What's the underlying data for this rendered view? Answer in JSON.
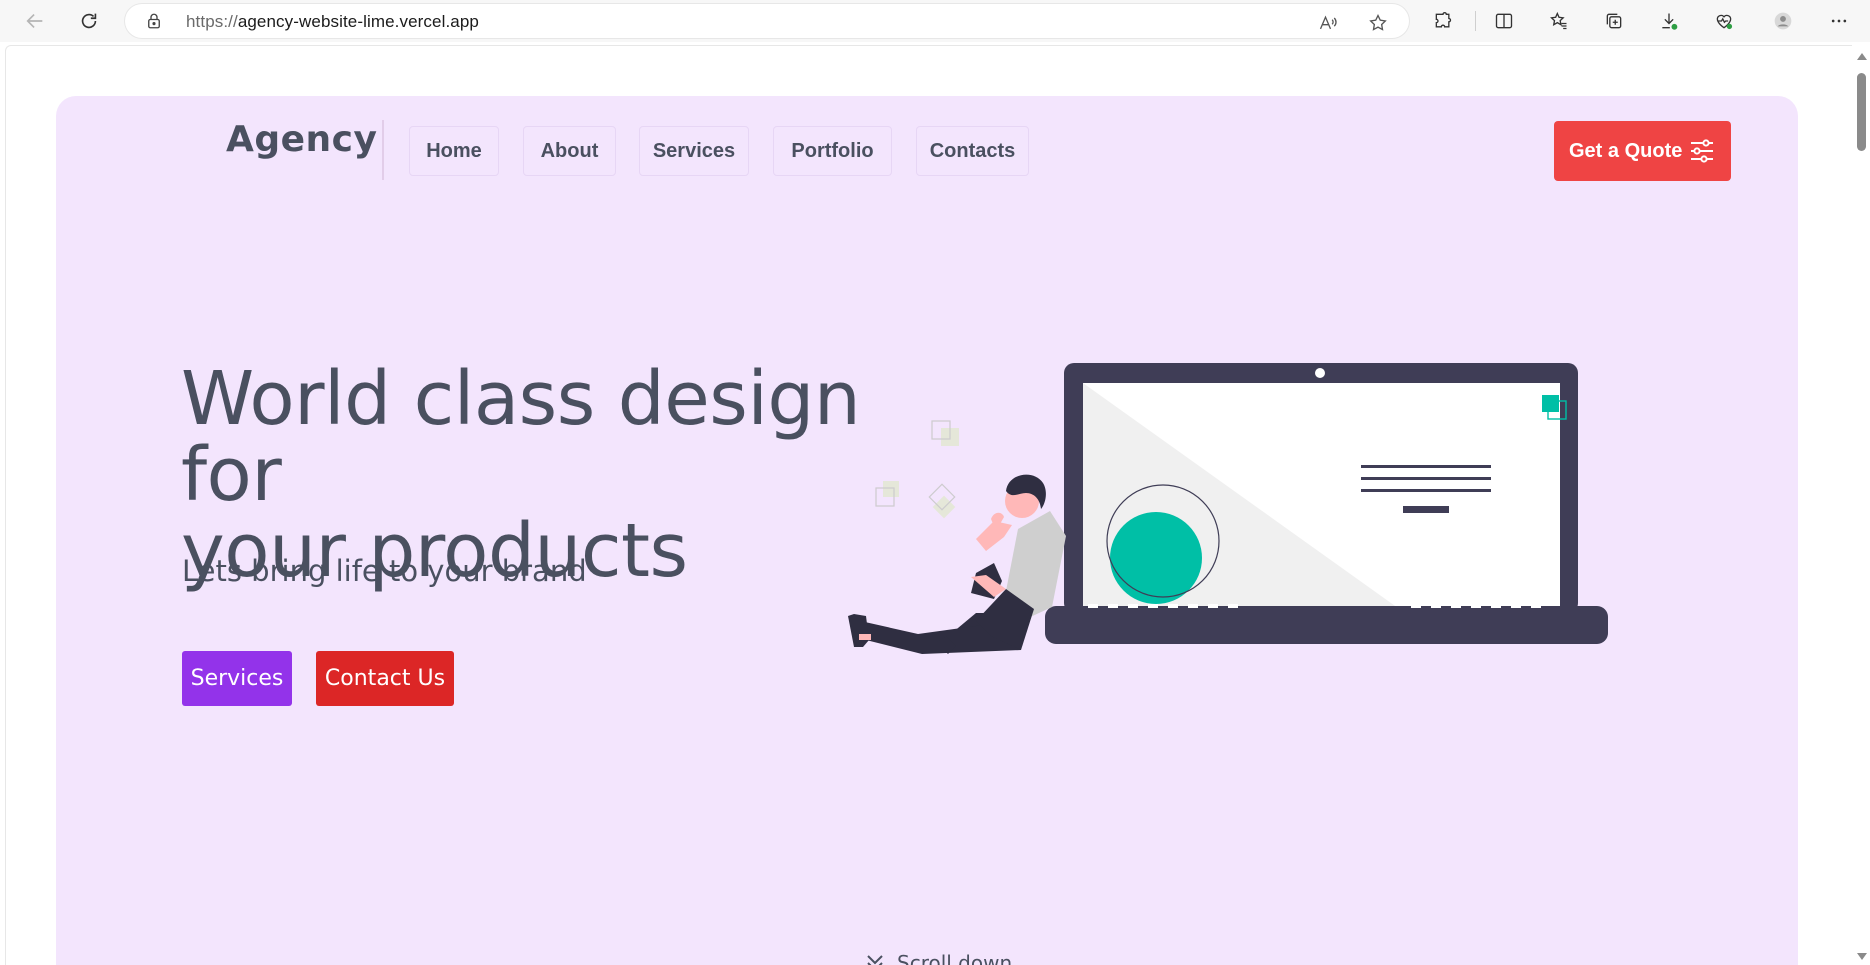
{
  "browser": {
    "url_scheme": "https://",
    "url_host": "agency-website-lime.vercel.app",
    "icons": {
      "back": "back-arrow-icon",
      "refresh": "refresh-icon",
      "lock": "lock-icon",
      "read_aloud": "read-aloud-icon",
      "favorite": "star-icon",
      "extensions": "puzzle-icon",
      "split_screen": "split-screen-icon",
      "favorites": "favorites-icon",
      "collections": "collections-icon",
      "downloads": "download-icon",
      "browser_essentials": "heart-pulse-icon",
      "profile": "profile-icon",
      "more": "more-icon"
    }
  },
  "header": {
    "logo": "Agency",
    "nav": [
      "Home",
      "About",
      "Services",
      "Portfolio",
      "Contacts"
    ],
    "cta_label": "Get a Quote"
  },
  "hero": {
    "headline_line1": "World class design for",
    "headline_line2": "your products",
    "subline": "Lets bring life to your brand",
    "primary_button": "Services",
    "secondary_button": "Contact Us",
    "scroll_label": "Scroll down"
  },
  "colors": {
    "hero_bg": "#f3e5fd",
    "text": "#4a5060",
    "quote_btn": "#ef4444",
    "services_btn": "#9333ea",
    "contact_btn": "#dc2626",
    "laptop": "#3f3d56",
    "accent_teal": "#00bfa6"
  }
}
